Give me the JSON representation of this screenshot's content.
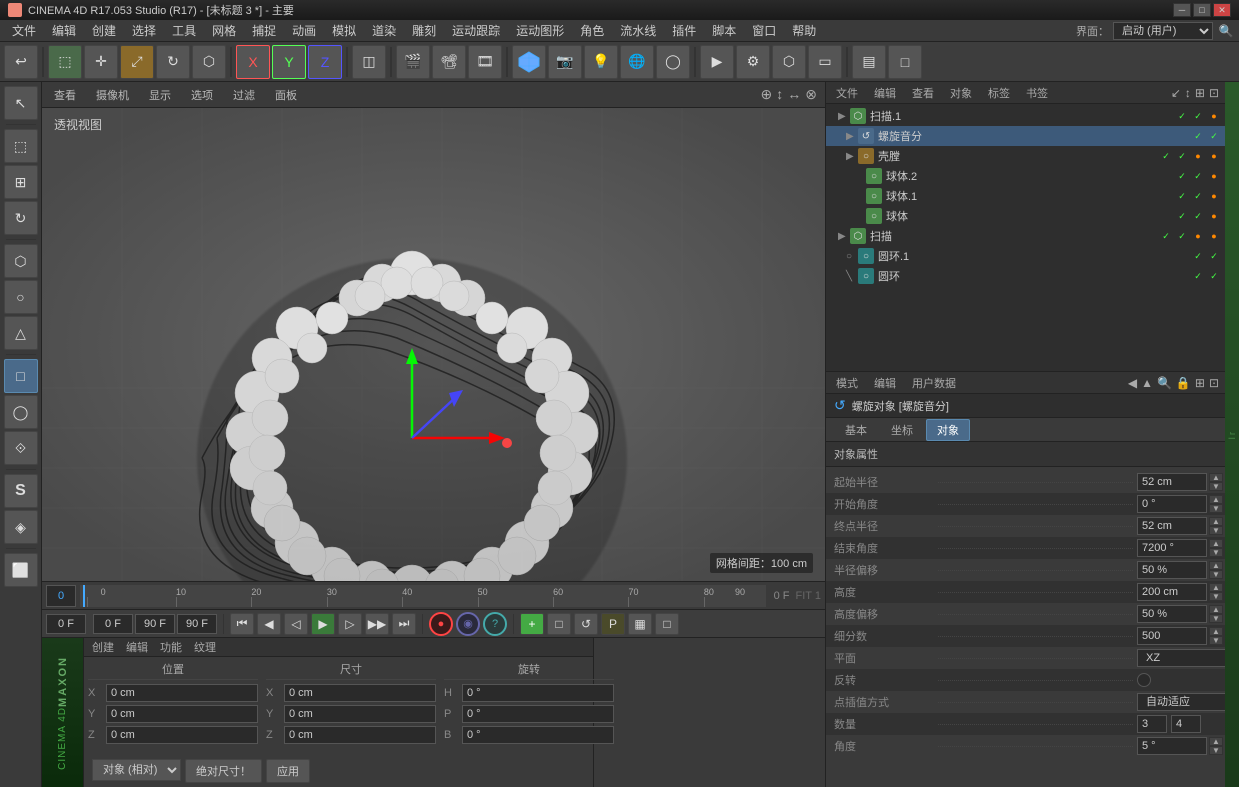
{
  "titlebar": {
    "title": "CINEMA 4D R17.053 Studio (R17) - [未标题 3 *] - 主要",
    "icon": "C4D",
    "controls": [
      "─",
      "□",
      "✕"
    ]
  },
  "menubar": {
    "items": [
      "文件",
      "编辑",
      "创建",
      "选择",
      "工具",
      "网格",
      "捕捉",
      "动画",
      "模拟",
      "道染",
      "雕刻",
      "运动跟踪",
      "运动图形",
      "角色",
      "流水线",
      "流水线",
      "插件",
      "脚本",
      "窗口",
      "帮助"
    ],
    "interface_label": "界面：",
    "interface_value": "启动 (用户)"
  },
  "viewport": {
    "header_items": [
      "查看",
      "摄像机",
      "显示",
      "选项",
      "过滤",
      "面板"
    ],
    "label": "透视视图",
    "grid_label": "网格间距：100 cm"
  },
  "object_manager": {
    "tabs": [
      "文件",
      "编辑",
      "查看",
      "对象",
      "标签",
      "书签"
    ],
    "objects": [
      {
        "id": 1,
        "name": "扫描.1",
        "indent": 0,
        "icon_color": "green",
        "arrow": "▶",
        "flags": [
          "✓",
          "✓",
          "●"
        ]
      },
      {
        "id": 2,
        "name": "螺旋音分",
        "indent": 1,
        "icon_color": "blue",
        "arrow": "▶",
        "flags": [
          "✓",
          "✓"
        ],
        "selected": true
      },
      {
        "id": 3,
        "name": "壳膛",
        "indent": 1,
        "icon_color": "orange",
        "arrow": "▶",
        "flags": [
          "✓",
          "✓",
          "●",
          "●"
        ]
      },
      {
        "id": 4,
        "name": "球体.2",
        "indent": 2,
        "icon_color": "green",
        "arrow": "",
        "flags": [
          "✓",
          "✓",
          "●"
        ]
      },
      {
        "id": 5,
        "name": "球体.1",
        "indent": 2,
        "icon_color": "green",
        "arrow": "",
        "flags": [
          "✓",
          "✓",
          "●"
        ]
      },
      {
        "id": 6,
        "name": "球体",
        "indent": 2,
        "icon_color": "green",
        "arrow": "",
        "flags": [
          "✓",
          "✓",
          "●"
        ]
      },
      {
        "id": 7,
        "name": "扫描",
        "indent": 0,
        "icon_color": "green",
        "arrow": "▶",
        "flags": [
          "✓",
          "✓",
          "●",
          "●"
        ]
      },
      {
        "id": 8,
        "name": "圆环.1",
        "indent": 1,
        "icon_color": "teal",
        "arrow": "",
        "flags": [
          "✓",
          "✓"
        ]
      },
      {
        "id": 9,
        "name": "圆环",
        "indent": 1,
        "icon_color": "teal",
        "arrow": "",
        "flags": [
          "✓",
          "✓"
        ]
      }
    ]
  },
  "properties": {
    "toolbar_items": [
      "模式",
      "编辑",
      "用户数据"
    ],
    "object_title": "螺旋对象 [螺旋音分]",
    "subtabs": [
      "基本",
      "坐标",
      "对象"
    ],
    "active_subtab": "对象",
    "section_title": "对象属性",
    "properties": [
      {
        "label": "起始半径",
        "dots": true,
        "value": "52 cm",
        "type": "spinner"
      },
      {
        "label": "开始角度",
        "dots": true,
        "value": "0 °",
        "type": "spinner"
      },
      {
        "label": "终点半径",
        "dots": true,
        "value": "52 cm",
        "type": "spinner"
      },
      {
        "label": "结束角度",
        "dots": true,
        "value": "7200 °",
        "type": "spinner"
      },
      {
        "label": "半径偏移",
        "dots": true,
        "value": "50 %",
        "type": "spinner"
      },
      {
        "label": "高度",
        "dots": true,
        "value": "200 cm",
        "type": "spinner"
      },
      {
        "label": "高度偏移",
        "dots": true,
        "value": "50 %",
        "type": "spinner"
      },
      {
        "label": "细分数",
        "dots": true,
        "value": "500",
        "type": "spinner"
      },
      {
        "label": "平面",
        "dots": true,
        "value": "XZ",
        "type": "dropdown"
      },
      {
        "label": "反转",
        "dots": true,
        "value": "",
        "type": "checkbox"
      },
      {
        "label": "点插值方式",
        "dots": true,
        "value": "自动适应",
        "type": "dropdown"
      },
      {
        "label": "数量",
        "dots": true,
        "value": "3    4",
        "type": "dual"
      },
      {
        "label": "角度",
        "dots": true,
        "value": "5 °",
        "type": "spinner"
      }
    ]
  },
  "timeline": {
    "frame_start": "0",
    "frame_end": "90 F",
    "current_frame": "0 F",
    "ticks": [
      0,
      10,
      20,
      30,
      40,
      50,
      60,
      70,
      80,
      90
    ],
    "indicators": [
      "0 FIT 1"
    ]
  },
  "transport": {
    "frame_current": "0 F",
    "frame_start": "0 F",
    "frame_end": "90 F",
    "frame_step": "90 F",
    "buttons": [
      "⏮",
      "◀",
      "▶",
      "▶▶",
      "⏭"
    ],
    "record_buttons": [
      "●",
      "◉",
      "?"
    ],
    "extra_buttons": [
      "+",
      "□",
      "↺",
      "P",
      "▦",
      "□"
    ]
  },
  "bottom": {
    "tabs": [
      "创建",
      "编辑",
      "功能",
      "纹理"
    ],
    "position": {
      "label": "位置",
      "x": "0 cm",
      "y": "0 cm",
      "z": "0 cm"
    },
    "size": {
      "label": "尺寸",
      "x": "0 cm",
      "y": "0 cm",
      "z": "0 cm"
    },
    "rotation": {
      "label": "旋转",
      "h": "0 °",
      "p": "0 °",
      "b": "0 °"
    },
    "buttons": [
      "对象 (相对)",
      "绝对尺寸！",
      "应用"
    ]
  },
  "icons": {
    "undo": "↩",
    "redo": "↪",
    "move": "✛",
    "rotate": "↻",
    "scale": "⤢",
    "select": "⬚",
    "live": "▶",
    "render": "■",
    "viewport_icons": [
      "⊕",
      "↕",
      "↔",
      "⊗"
    ],
    "sidebar": [
      "↖",
      "⬚",
      "⬚",
      "⬡",
      "○",
      "△",
      "□",
      "◯",
      "⟐",
      "S",
      "◈",
      "⬜"
    ]
  }
}
